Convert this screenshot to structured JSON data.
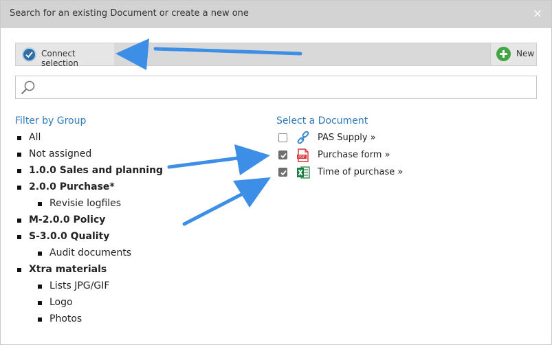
{
  "dialog": {
    "title": "Search for an existing Document or create a new one",
    "close_symbol": "×"
  },
  "toolbar": {
    "connect_label": "Connect selection",
    "connect_icon": "check-circle-icon",
    "new_label": "New",
    "new_icon": "plus-circle-icon"
  },
  "search": {
    "value": "",
    "placeholder": "",
    "icon": "search-icon"
  },
  "filter": {
    "heading": "Filter by Group",
    "groups": [
      {
        "label": "All",
        "level": 0,
        "bold": false
      },
      {
        "label": "Not assigned",
        "level": 0,
        "bold": false
      },
      {
        "label": "1.0.0 Sales and planning",
        "level": 0,
        "bold": true
      },
      {
        "label": "2.0.0 Purchase*",
        "level": 0,
        "bold": true
      },
      {
        "label": "Revisie logfiles",
        "level": 1,
        "bold": false
      },
      {
        "label": "M-2.0.0 Policy",
        "level": 0,
        "bold": true
      },
      {
        "label": "S-3.0.0 Quality",
        "level": 0,
        "bold": true
      },
      {
        "label": "Audit documents",
        "level": 1,
        "bold": false
      },
      {
        "label": "Xtra materials",
        "level": 0,
        "bold": true
      },
      {
        "label": "Lists JPG/GIF",
        "level": 1,
        "bold": false
      },
      {
        "label": "Logo",
        "level": 1,
        "bold": false
      },
      {
        "label": "Photos",
        "level": 1,
        "bold": false
      }
    ]
  },
  "documents": {
    "heading": "Select a Document",
    "items": [
      {
        "label": "PAS Supply »",
        "checked": false,
        "icon": "link-icon"
      },
      {
        "label": "Purchase form »",
        "checked": true,
        "icon": "pdf-icon"
      },
      {
        "label": "Time of purchase »",
        "checked": true,
        "icon": "excel-icon"
      }
    ]
  },
  "colors": {
    "accent_blue": "#2f79b9",
    "annotation_arrow": "#3d8ee6",
    "titlebar": "#d3d3d3",
    "new_green": "#44a544"
  }
}
